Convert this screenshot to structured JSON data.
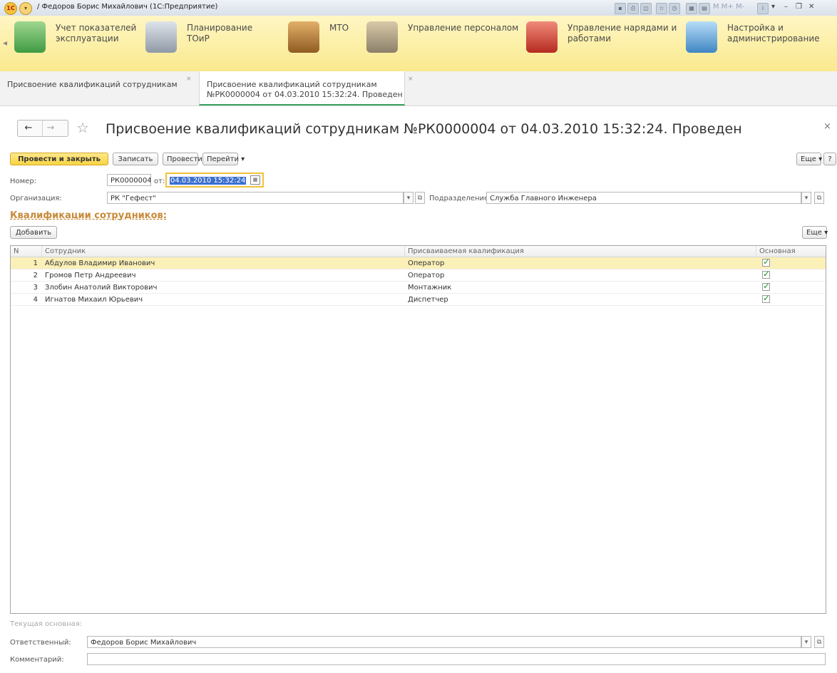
{
  "window": {
    "title": "/ Федоров Борис Михайлович (1С:Предприятие)",
    "status_text": "M   M+  M-"
  },
  "sections": [
    {
      "label": "Учет показателей\nэксплуатации",
      "icon": "chart-bars-icon",
      "color": "#5bb25a"
    },
    {
      "label": "Планирование ТОиР",
      "icon": "drafting-compass-icon",
      "color": "#7f8a97"
    },
    {
      "label": "МТО",
      "icon": "cargo-boxes-icon",
      "color": "#b9823f"
    },
    {
      "label": "Управление персоналом",
      "icon": "person-coins-icon",
      "color": "#8b7f6a"
    },
    {
      "label": "Управление нарядами и\nработами",
      "icon": "tools-wrench-icon",
      "color": "#c8392c"
    },
    {
      "label": "Настройка и\nадминистрирование",
      "icon": "database-settings-icon",
      "color": "#5f9ccf"
    }
  ],
  "tabs": [
    {
      "label": "Присвоение квалификаций сотрудникам"
    },
    {
      "label": "Присвоение квалификаций сотрудникам\n№РК0000004 от 04.03.2010 15:32:24. Проведен"
    }
  ],
  "form": {
    "title": "Присвоение квалификаций сотрудникам №РК0000004 от 04.03.2010 15:32:24. Проведен",
    "close_symbol": "×"
  },
  "toolbar": {
    "post_close": "Провести и закрыть",
    "save": "Записать",
    "post": "Провести",
    "goto": "Перейти ▾",
    "more": "Еще ▾",
    "help": "?"
  },
  "fields": {
    "number_label": "Номер:",
    "number_value": "РК0000004",
    "date_label": "от:",
    "date_value": "04.03.2010 15:32:24",
    "org_label": "Организация:",
    "org_value": "РК \"Гефест\"",
    "dept_label": "Подразделение:",
    "dept_value": "Служба Главного Инженера"
  },
  "qualifications": {
    "section_title": "Квалификации сотрудников:",
    "add_button": "Добавить",
    "more_button": "Еще ▾",
    "columns": [
      "N",
      "Сотрудник",
      "Присваиваемая квалификация",
      "Основная"
    ],
    "rows": [
      {
        "n": "1",
        "employee": "Абдулов Владимир Иванович",
        "qualification": "Оператор",
        "main": true
      },
      {
        "n": "2",
        "employee": "Громов Петр Андреевич",
        "qualification": "Оператор",
        "main": true
      },
      {
        "n": "3",
        "employee": "Злобин Анатолий Викторович",
        "qualification": "Монтажник",
        "main": true
      },
      {
        "n": "4",
        "employee": "Игнатов Михаил Юрьевич",
        "qualification": "Диспетчер",
        "main": true
      }
    ]
  },
  "footer": {
    "current_main_label": "Текущая основная:",
    "responsible_label": "Ответственный:",
    "responsible_value": "Федоров Борис Михайлович",
    "comment_label": "Комментарий:",
    "comment_value": ""
  }
}
